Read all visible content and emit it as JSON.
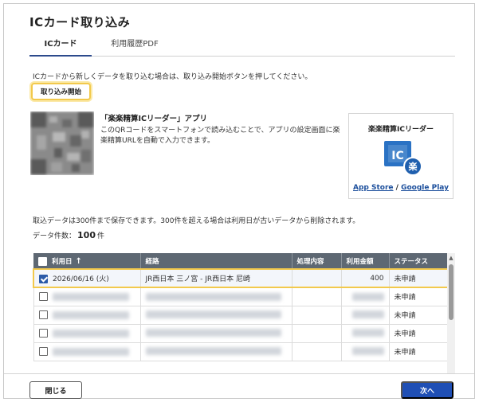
{
  "dialog": {
    "title": "ICカード取り込み",
    "tabs": [
      {
        "label": "ICカード",
        "active": true
      },
      {
        "label": "利用履歴PDF",
        "active": false
      }
    ],
    "info_text": "ICカードから新しくデータを取り込む場合は、取り込み開始ボタンを押してください。",
    "start_button": "取り込み開始",
    "app": {
      "title": "「楽楽精算ICリーダー」アプリ",
      "description": "このQRコードをスマートフォンで読み込むことで、アプリの設定画面に楽楽精算URLを自動で入力できます。",
      "card_title": "楽楽精算ICリーダー",
      "icon_text": "IC",
      "icon_badge": "楽",
      "app_store": "App Store",
      "separator": "/",
      "google_play": "Google Play"
    },
    "retention_text": "取込データは300件まで保存できます。300件を超える場合は利用日が古いデータから削除されます。",
    "count_label": "データ件数：",
    "count_value": "100",
    "count_unit": "件"
  },
  "table": {
    "headers": {
      "date": "利用日",
      "sort_indicator": "↑",
      "route": "経路",
      "process": "処理内容",
      "amount": "利用金額",
      "status": "ステータス"
    },
    "rows": [
      {
        "checked": true,
        "date": "2026/06/16 (火)",
        "route": "JR西日本 三ノ宮 - JR西日本 尼崎",
        "process": "",
        "amount": "400",
        "status": "未申請"
      },
      {
        "checked": false,
        "date": "",
        "route": "",
        "process": "",
        "amount": "",
        "status": "未申請"
      },
      {
        "checked": false,
        "date": "",
        "route": "",
        "process": "",
        "amount": "",
        "status": "未申請"
      },
      {
        "checked": false,
        "date": "",
        "route": "",
        "process": "",
        "amount": "",
        "status": "未申請"
      },
      {
        "checked": false,
        "date": "",
        "route": "",
        "process": "",
        "amount": "",
        "status": "未申請"
      }
    ]
  },
  "footer": {
    "close_button": "閉じる",
    "next_button": "次へ"
  },
  "colors": {
    "header_bg": "#5e6873",
    "primary": "#1f4fb5",
    "highlight": "#f2c94c",
    "link": "#1c4f9c"
  }
}
